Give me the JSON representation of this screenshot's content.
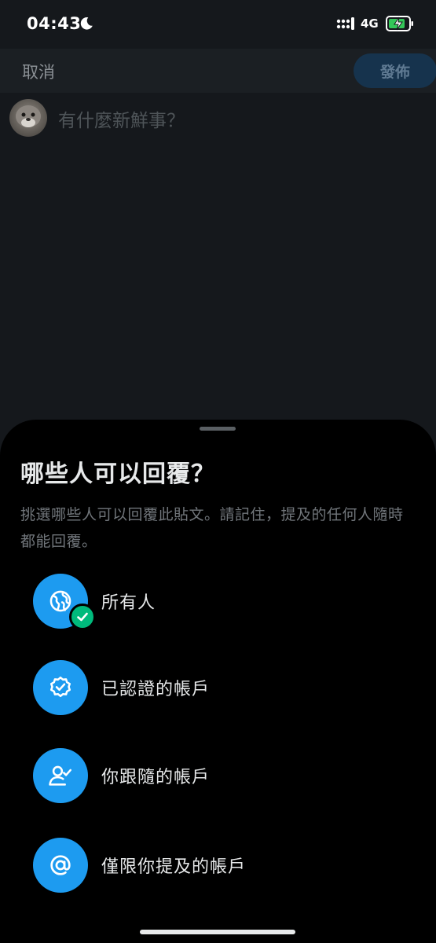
{
  "status_bar": {
    "time": "04:43",
    "network": "4G",
    "icons": [
      "moon-icon",
      "signal-icon",
      "battery-charging-icon"
    ]
  },
  "compose": {
    "cancel_label": "取消",
    "post_label": "發佈",
    "placeholder": "有什麼新鮮事？"
  },
  "reply_sheet": {
    "title": "哪些人可以回覆？",
    "description": "挑選哪些人可以回覆此貼文。請記住，提及的任何人隨時都能回覆。",
    "selected_option": "everyone",
    "options": [
      {
        "id": "everyone",
        "label": "所有人",
        "icon": "globe-icon"
      },
      {
        "id": "verified",
        "label": "已認證的帳戶",
        "icon": "verified-badge-icon"
      },
      {
        "id": "following",
        "label": "你跟隨的帳戶",
        "icon": "person-check-icon"
      },
      {
        "id": "mentioned",
        "label": "僅限你提及的帳戶",
        "icon": "at-sign-icon"
      }
    ]
  },
  "colors": {
    "accent": "#1d9bf0",
    "selected_check": "#00ba7c",
    "sheet_background": "#000000",
    "dimmed_background": "#15181c"
  }
}
